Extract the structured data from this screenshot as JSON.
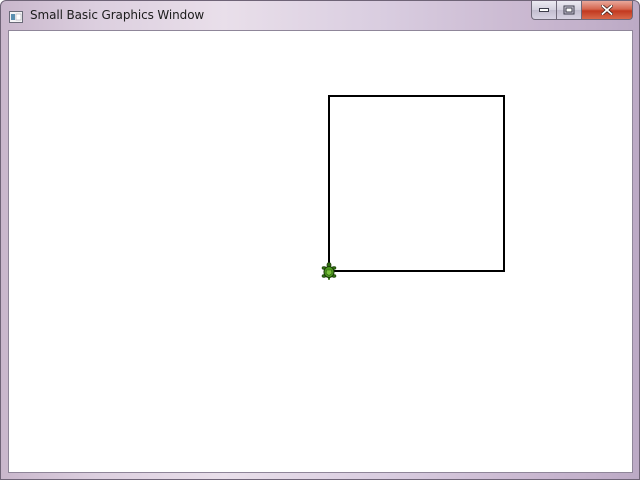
{
  "window": {
    "title": "Small Basic Graphics Window",
    "icon": "small-basic-app-icon"
  },
  "caption_buttons": {
    "minimize_icon": "minimize-icon",
    "maximize_icon": "maximize-icon",
    "close_icon": "close-icon"
  },
  "canvas": {
    "background": "#ffffff",
    "drawing": {
      "shape": "square",
      "pen_color": "#000000"
    },
    "turtle": {
      "icon": "turtle-icon",
      "color": "#3f8a1a"
    }
  }
}
